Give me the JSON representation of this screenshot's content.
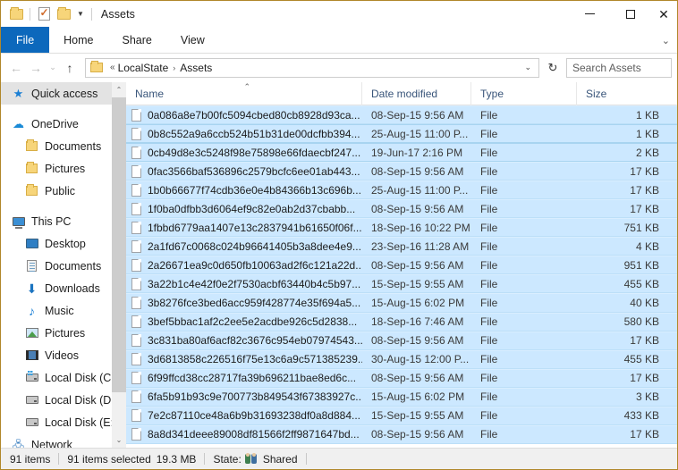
{
  "window": {
    "title": "Assets",
    "quick_access_toolbar": [
      {
        "name": "folder-properties-icon",
        "label": ""
      },
      {
        "name": "properties-icon",
        "label": ""
      },
      {
        "name": "new-folder-icon",
        "label": ""
      }
    ],
    "controls": {
      "minimize": "—",
      "maximize": "□",
      "close": "✕"
    }
  },
  "ribbon": {
    "tabs": [
      {
        "label": "File",
        "active": true
      },
      {
        "label": "Home",
        "active": false
      },
      {
        "label": "Share",
        "active": false
      },
      {
        "label": "View",
        "active": false
      }
    ],
    "expand_icon": "⌄"
  },
  "addressbar": {
    "back_icon": "←",
    "forward_icon": "→",
    "recent_icon": "⌄",
    "up_icon": "↑",
    "overflow": "«",
    "crumbs": [
      "LocalState",
      "Assets"
    ],
    "separator": "›",
    "dropdown_icon": "⌄",
    "refresh_icon": "↻",
    "search_placeholder": "Search Assets"
  },
  "sidebar": {
    "scroll_up_icon": "⌃",
    "scroll_down_icon": "⌄",
    "items": [
      {
        "label": "Quick access",
        "icon": "pin-star-icon",
        "level": "root",
        "selected": true
      },
      {
        "label": "OneDrive",
        "icon": "cloud-icon",
        "level": "root",
        "selected": false
      },
      {
        "label": "Documents",
        "icon": "folder-icon",
        "level": "child",
        "selected": false
      },
      {
        "label": "Pictures",
        "icon": "folder-icon",
        "level": "child",
        "selected": false
      },
      {
        "label": "Public",
        "icon": "folder-icon",
        "level": "child",
        "selected": false
      },
      {
        "label": "This PC",
        "icon": "this-pc-icon",
        "level": "root",
        "selected": false
      },
      {
        "label": "Desktop",
        "icon": "desktop-icon",
        "level": "child",
        "selected": false
      },
      {
        "label": "Documents",
        "icon": "documents-icon",
        "level": "child",
        "selected": false
      },
      {
        "label": "Downloads",
        "icon": "downloads-icon",
        "level": "child",
        "selected": false
      },
      {
        "label": "Music",
        "icon": "music-icon",
        "level": "child",
        "selected": false
      },
      {
        "label": "Pictures",
        "icon": "pictures-icon",
        "level": "child",
        "selected": false
      },
      {
        "label": "Videos",
        "icon": "videos-icon",
        "level": "child",
        "selected": false
      },
      {
        "label": "Local Disk (C:)",
        "icon": "windows-disk-icon",
        "level": "child",
        "selected": false
      },
      {
        "label": "Local Disk (D:)",
        "icon": "disk-icon",
        "level": "child",
        "selected": false
      },
      {
        "label": "Local Disk (E:)",
        "icon": "disk-icon",
        "level": "child",
        "selected": false
      },
      {
        "label": "Network",
        "icon": "network-icon",
        "level": "root",
        "selected": false
      }
    ]
  },
  "filelist": {
    "columns": [
      {
        "label": "Name",
        "sorted": true,
        "sort_icon": "⌃"
      },
      {
        "label": "Date modified",
        "sorted": false
      },
      {
        "label": "Type",
        "sorted": false
      },
      {
        "label": "Size",
        "sorted": false
      }
    ],
    "rows": [
      {
        "name": "0a086a8e7b00fc5094cbed80cb8928d93ca...",
        "date": "08-Sep-15 9:56 AM",
        "type": "File",
        "size": "1 KB"
      },
      {
        "name": "0b8c552a9a6ccb524b51b31de00dcfbb394...",
        "date": "25-Aug-15 11:00 P...",
        "type": "File",
        "size": "1 KB"
      },
      {
        "name": "0cb49d8e3c5248f98e75898e66fdaecbf247...",
        "date": "19-Jun-17 2:16 PM",
        "type": "File",
        "size": "2 KB"
      },
      {
        "name": "0fac3566baf536896c2579bcfc6ee01ab443...",
        "date": "08-Sep-15 9:56 AM",
        "type": "File",
        "size": "17 KB"
      },
      {
        "name": "1b0b66677f74cdb36e0e4b84366b13c696b...",
        "date": "25-Aug-15 11:00 P...",
        "type": "File",
        "size": "17 KB"
      },
      {
        "name": "1f0ba0dfbb3d6064ef9c82e0ab2d37cbabb...",
        "date": "08-Sep-15 9:56 AM",
        "type": "File",
        "size": "17 KB"
      },
      {
        "name": "1fbbd6779aa1407e13c2837941b61650f06f...",
        "date": "18-Sep-16 10:22 PM",
        "type": "File",
        "size": "751 KB"
      },
      {
        "name": "2a1fd67c0068c024b96641405b3a8dee4e9...",
        "date": "23-Sep-16 11:28 AM",
        "type": "File",
        "size": "4 KB"
      },
      {
        "name": "2a26671ea9c0d650fb10063ad2f6c121a22d...",
        "date": "08-Sep-15 9:56 AM",
        "type": "File",
        "size": "951 KB"
      },
      {
        "name": "3a22b1c4e42f0e2f7530acbf63440b4c5b97...",
        "date": "15-Sep-15 9:55 AM",
        "type": "File",
        "size": "455 KB"
      },
      {
        "name": "3b8276fce3bed6acc959f428774e35f694a5...",
        "date": "15-Aug-15 6:02 PM",
        "type": "File",
        "size": "40 KB"
      },
      {
        "name": "3bef5bbac1af2c2ee5e2acdbe926c5d2838...",
        "date": "18-Sep-16 7:46 AM",
        "type": "File",
        "size": "580 KB"
      },
      {
        "name": "3c831ba80af6acf82c3676c954eb07974543...",
        "date": "08-Sep-15 9:56 AM",
        "type": "File",
        "size": "17 KB"
      },
      {
        "name": "3d6813858c226516f75e13c6a9c571385239...",
        "date": "30-Aug-15 12:00 P...",
        "type": "File",
        "size": "455 KB"
      },
      {
        "name": "6f99ffcd38cc28717fa39b696211bae8ed6c...",
        "date": "08-Sep-15 9:56 AM",
        "type": "File",
        "size": "17 KB"
      },
      {
        "name": "6fa5b91b93c9e700773b849543f67383927c...",
        "date": "15-Aug-15 6:02 PM",
        "type": "File",
        "size": "3 KB"
      },
      {
        "name": "7e2c87110ce48a6b9b31693238df0a8d884...",
        "date": "15-Sep-15 9:55 AM",
        "type": "File",
        "size": "433 KB"
      },
      {
        "name": "8a8d341deee89008df81566f2ff9871647bd...",
        "date": "08-Sep-15 9:56 AM",
        "type": "File",
        "size": "17 KB"
      }
    ]
  },
  "statusbar": {
    "item_count": "91 items",
    "selection": "91 items selected",
    "selection_size": "19.3 MB",
    "state_label": "State:",
    "state_value": "Shared"
  },
  "colors": {
    "accent": "#0c68bc",
    "selection_bg": "#cce8ff",
    "window_border": "#b0872a",
    "column_header_text": "#39557a"
  }
}
